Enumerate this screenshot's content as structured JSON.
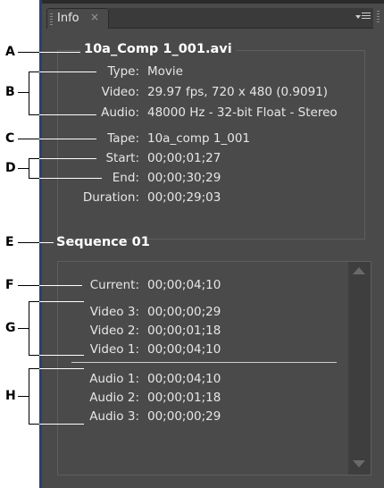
{
  "panel": {
    "tab_label": "Info",
    "close_glyph": "×",
    "menu_icon": "panel-menu-icon"
  },
  "clip": {
    "name": "10a_Comp 1_001.avi",
    "rows": [
      {
        "label": "Type:",
        "value": "Movie"
      },
      {
        "label": "Video:",
        "value": "29.97 fps, 720 x 480 (0.9091)"
      },
      {
        "label": "Audio:",
        "value": "48000 Hz - 32-bit Float - Stereo"
      },
      {
        "label": "Tape:",
        "value": "10a_comp 1_001"
      },
      {
        "label": "Start:",
        "value": "00;00;01;27"
      },
      {
        "label": "End:",
        "value": "00;00;30;29"
      },
      {
        "label": "Duration:",
        "value": "00;00;29;03"
      }
    ]
  },
  "sequence": {
    "name": "Sequence 01",
    "current": {
      "label": "Current:",
      "value": "00;00;04;10"
    },
    "video": [
      {
        "label": "Video 3:",
        "value": "00;00;00;29"
      },
      {
        "label": "Video 2:",
        "value": "00;00;01;18"
      },
      {
        "label": "Video 1:",
        "value": "00;00;04;10"
      }
    ],
    "audio": [
      {
        "label": "Audio 1:",
        "value": "00;00;04;10"
      },
      {
        "label": "Audio 2:",
        "value": "00;00;01;18"
      },
      {
        "label": "Audio 3:",
        "value": "00;00;00;29"
      }
    ]
  },
  "callouts": [
    "A",
    "B",
    "C",
    "D",
    "E",
    "F",
    "G",
    "H"
  ]
}
